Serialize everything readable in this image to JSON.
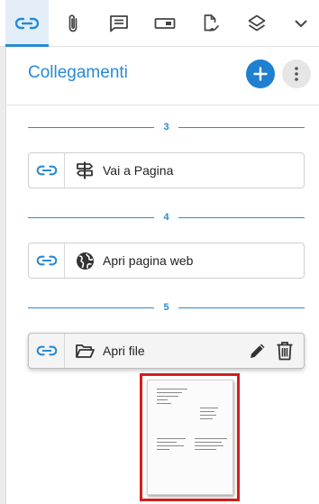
{
  "toolbar": {
    "tabs": [
      {
        "icon": "link-icon",
        "active": true
      },
      {
        "icon": "paperclip-icon",
        "active": false
      },
      {
        "icon": "comment-icon",
        "active": false
      },
      {
        "icon": "form-field-icon",
        "active": false
      },
      {
        "icon": "file-signature-icon",
        "active": false
      },
      {
        "icon": "layers-icon",
        "active": false
      },
      {
        "icon": "chevron-down-icon",
        "active": false
      }
    ]
  },
  "panel": {
    "title": "Collegamenti",
    "add_icon": "plus-icon",
    "menu_icon": "more-vert-icon"
  },
  "sections": [
    {
      "number": "3",
      "link_label": "Vai a Pagina",
      "type_icon": "signpost-icon"
    },
    {
      "number": "4",
      "link_label": "Apri pagina web",
      "type_icon": "globe-icon"
    },
    {
      "number": "5",
      "link_label": "Apri file",
      "type_icon": "folder-open-icon",
      "selected": true,
      "actions": [
        "pencil-icon",
        "trash-icon"
      ]
    }
  ],
  "thumbnail": {
    "icon": "document-preview",
    "highlight_color": "#d41e1e"
  },
  "colors": {
    "accent": "#2a8ad4",
    "fab": "#1f7fd0",
    "highlight": "#d41e1e"
  }
}
